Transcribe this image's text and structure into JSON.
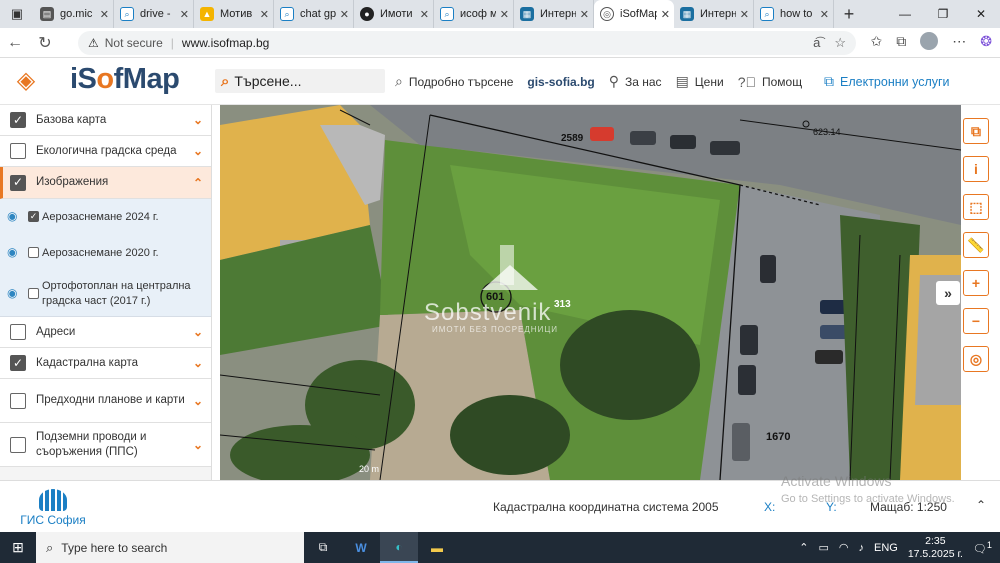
{
  "browser": {
    "tabs": [
      {
        "title": "go.mic",
        "color": "#555"
      },
      {
        "title": "drive - ",
        "color": "#1b7fc4"
      },
      {
        "title": "Мотив",
        "color": "#f4b400"
      },
      {
        "title": "chat gp",
        "color": "#1b7fc4"
      },
      {
        "title": "Имоти",
        "color": "#222"
      },
      {
        "title": "исоф м",
        "color": "#1b7fc4"
      },
      {
        "title": "Интерн",
        "color": "#1b6fa0"
      },
      {
        "title": "iSofMap",
        "color": "#555",
        "active": true
      },
      {
        "title": "Интерн",
        "color": "#1b6fa0"
      },
      {
        "title": "how to",
        "color": "#1b7fc4"
      }
    ],
    "security": "Not secure",
    "url": "www.isofmap.bg"
  },
  "header": {
    "logo_pre": "iS",
    "logo_o": "o",
    "logo_post": "fMap",
    "search_placeholder": "Търсене...",
    "links": {
      "detailed_search": "Подробно търсене",
      "gis": "gis-sofia.bg",
      "about": "За нас",
      "prices": "Цени",
      "help": "Помощ"
    },
    "eservices": "Електронни услуги"
  },
  "panel": {
    "base_map": "Базова карта",
    "eco": "Екологична градска среда",
    "images": "Изображения",
    "sub": {
      "aerial_2024": "Аерозаснемане 2024 г.",
      "aerial_2020": "Аерозаснемане 2020 г.",
      "ortho_2017": "Ортофотоплан на централна градска част (2017 г.)"
    },
    "addresses": "Адреси",
    "cadastral": "Кадастрална карта",
    "previous_plans": "Предходни планове и карти",
    "underground": "Подземни проводи и съоръжения (ППС)"
  },
  "map": {
    "labels": {
      "parcel_2589": "2589",
      "parcel_601": "601",
      "parcel_313": "313",
      "parcel_1670": "1670",
      "point_label": "623.14",
      "bottom_label": "20 m"
    },
    "watermark_name": "Sobstvenik",
    "watermark_sub": "ИМОТИ БЕЗ ПОСРЕДНИЦИ"
  },
  "footer": {
    "gis_logo_text": "ГИС София",
    "crs": "Кадастрална координатна система 2005",
    "x_label": "X:",
    "y_label": "Y:",
    "scale": "Мащаб: 1:250"
  },
  "activation": {
    "title": "Activate Windows",
    "subtitle": "Go to Settings to activate Windows."
  },
  "taskbar": {
    "search_placeholder": "Type here to search",
    "lang": "ENG",
    "time": "2:35",
    "date": "17.5.2025 г.",
    "notifications": "1"
  }
}
